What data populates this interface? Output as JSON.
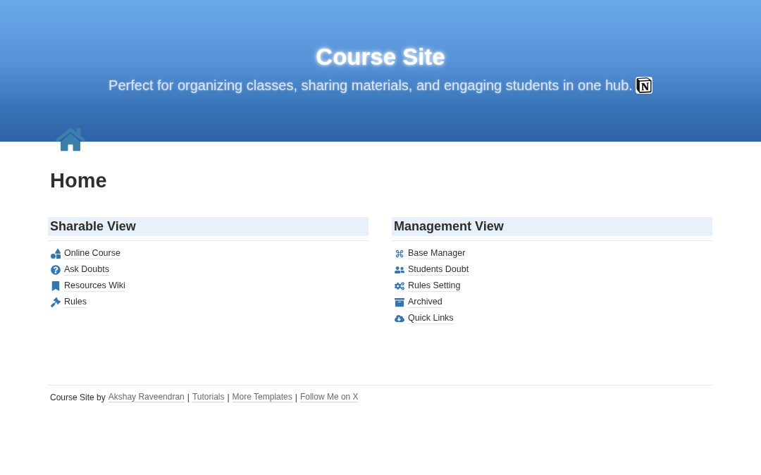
{
  "banner": {
    "title": "Course Site",
    "subtitle": "Perfect for organizing classes, sharing materials, and engaging students in one hub."
  },
  "page": {
    "title": "Home"
  },
  "sections": [
    {
      "title": "Sharable View",
      "links": [
        "Online Course",
        "Ask Doubts",
        "Resources Wiki",
        "Rules"
      ]
    },
    {
      "title": "Management View",
      "links": [
        "Base Manager",
        "Students Doubt",
        "Rules Setting",
        "Archived",
        "Quick Links"
      ]
    }
  ],
  "footer": [
    {
      "kind": "text",
      "text": "Course Site by"
    },
    {
      "kind": "link",
      "text": "Akshay Raveendran"
    },
    {
      "kind": "separator",
      "text": "|"
    },
    {
      "kind": "link",
      "text": "Tutorials"
    },
    {
      "kind": "separator",
      "text": "|"
    },
    {
      "kind": "link",
      "text": "More Templates"
    },
    {
      "kind": "separator",
      "text": "|"
    },
    {
      "kind": "link",
      "text": "Follow Me on X"
    }
  ]
}
